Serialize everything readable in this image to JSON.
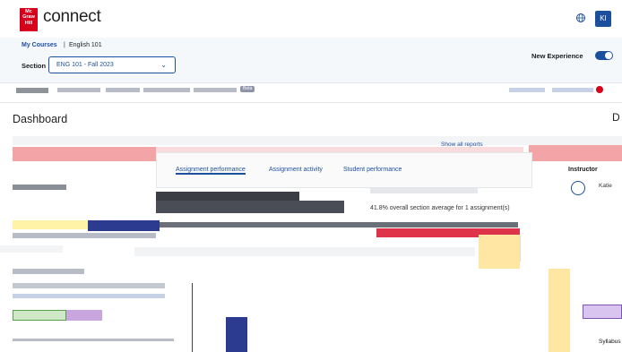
{
  "brand": {
    "logo_lines": [
      "Mc",
      "Graw",
      "Hill"
    ],
    "wordmark": "connect"
  },
  "header": {
    "avatar_initials": "KI",
    "globe_icon": "globe-icon"
  },
  "breadcrumb": {
    "link": "My Courses",
    "separator": "|",
    "current": "English 101"
  },
  "section": {
    "label": "Section",
    "selected": "ENG 101 - Fall 2023"
  },
  "new_experience": {
    "label": "New Experience",
    "enabled": true
  },
  "nav": {
    "beta_badge": "Beta"
  },
  "page": {
    "title": "Dashboard",
    "right_initial": "D"
  },
  "dashboard": {
    "show_all": "Show all reports",
    "tabs": [
      "Assignment performance",
      "Assignment activity",
      "Student performance"
    ],
    "metric_overall": "41.8% overall section average for 1 assignment(s)",
    "instructor_label": "Instructor",
    "instructor_name": "Katie",
    "syllabus": "Syllabus"
  },
  "colors": {
    "brand_red": "#d6001c",
    "accent_blue": "#1c4f9c",
    "bar_navy": "#2c3a8f"
  }
}
